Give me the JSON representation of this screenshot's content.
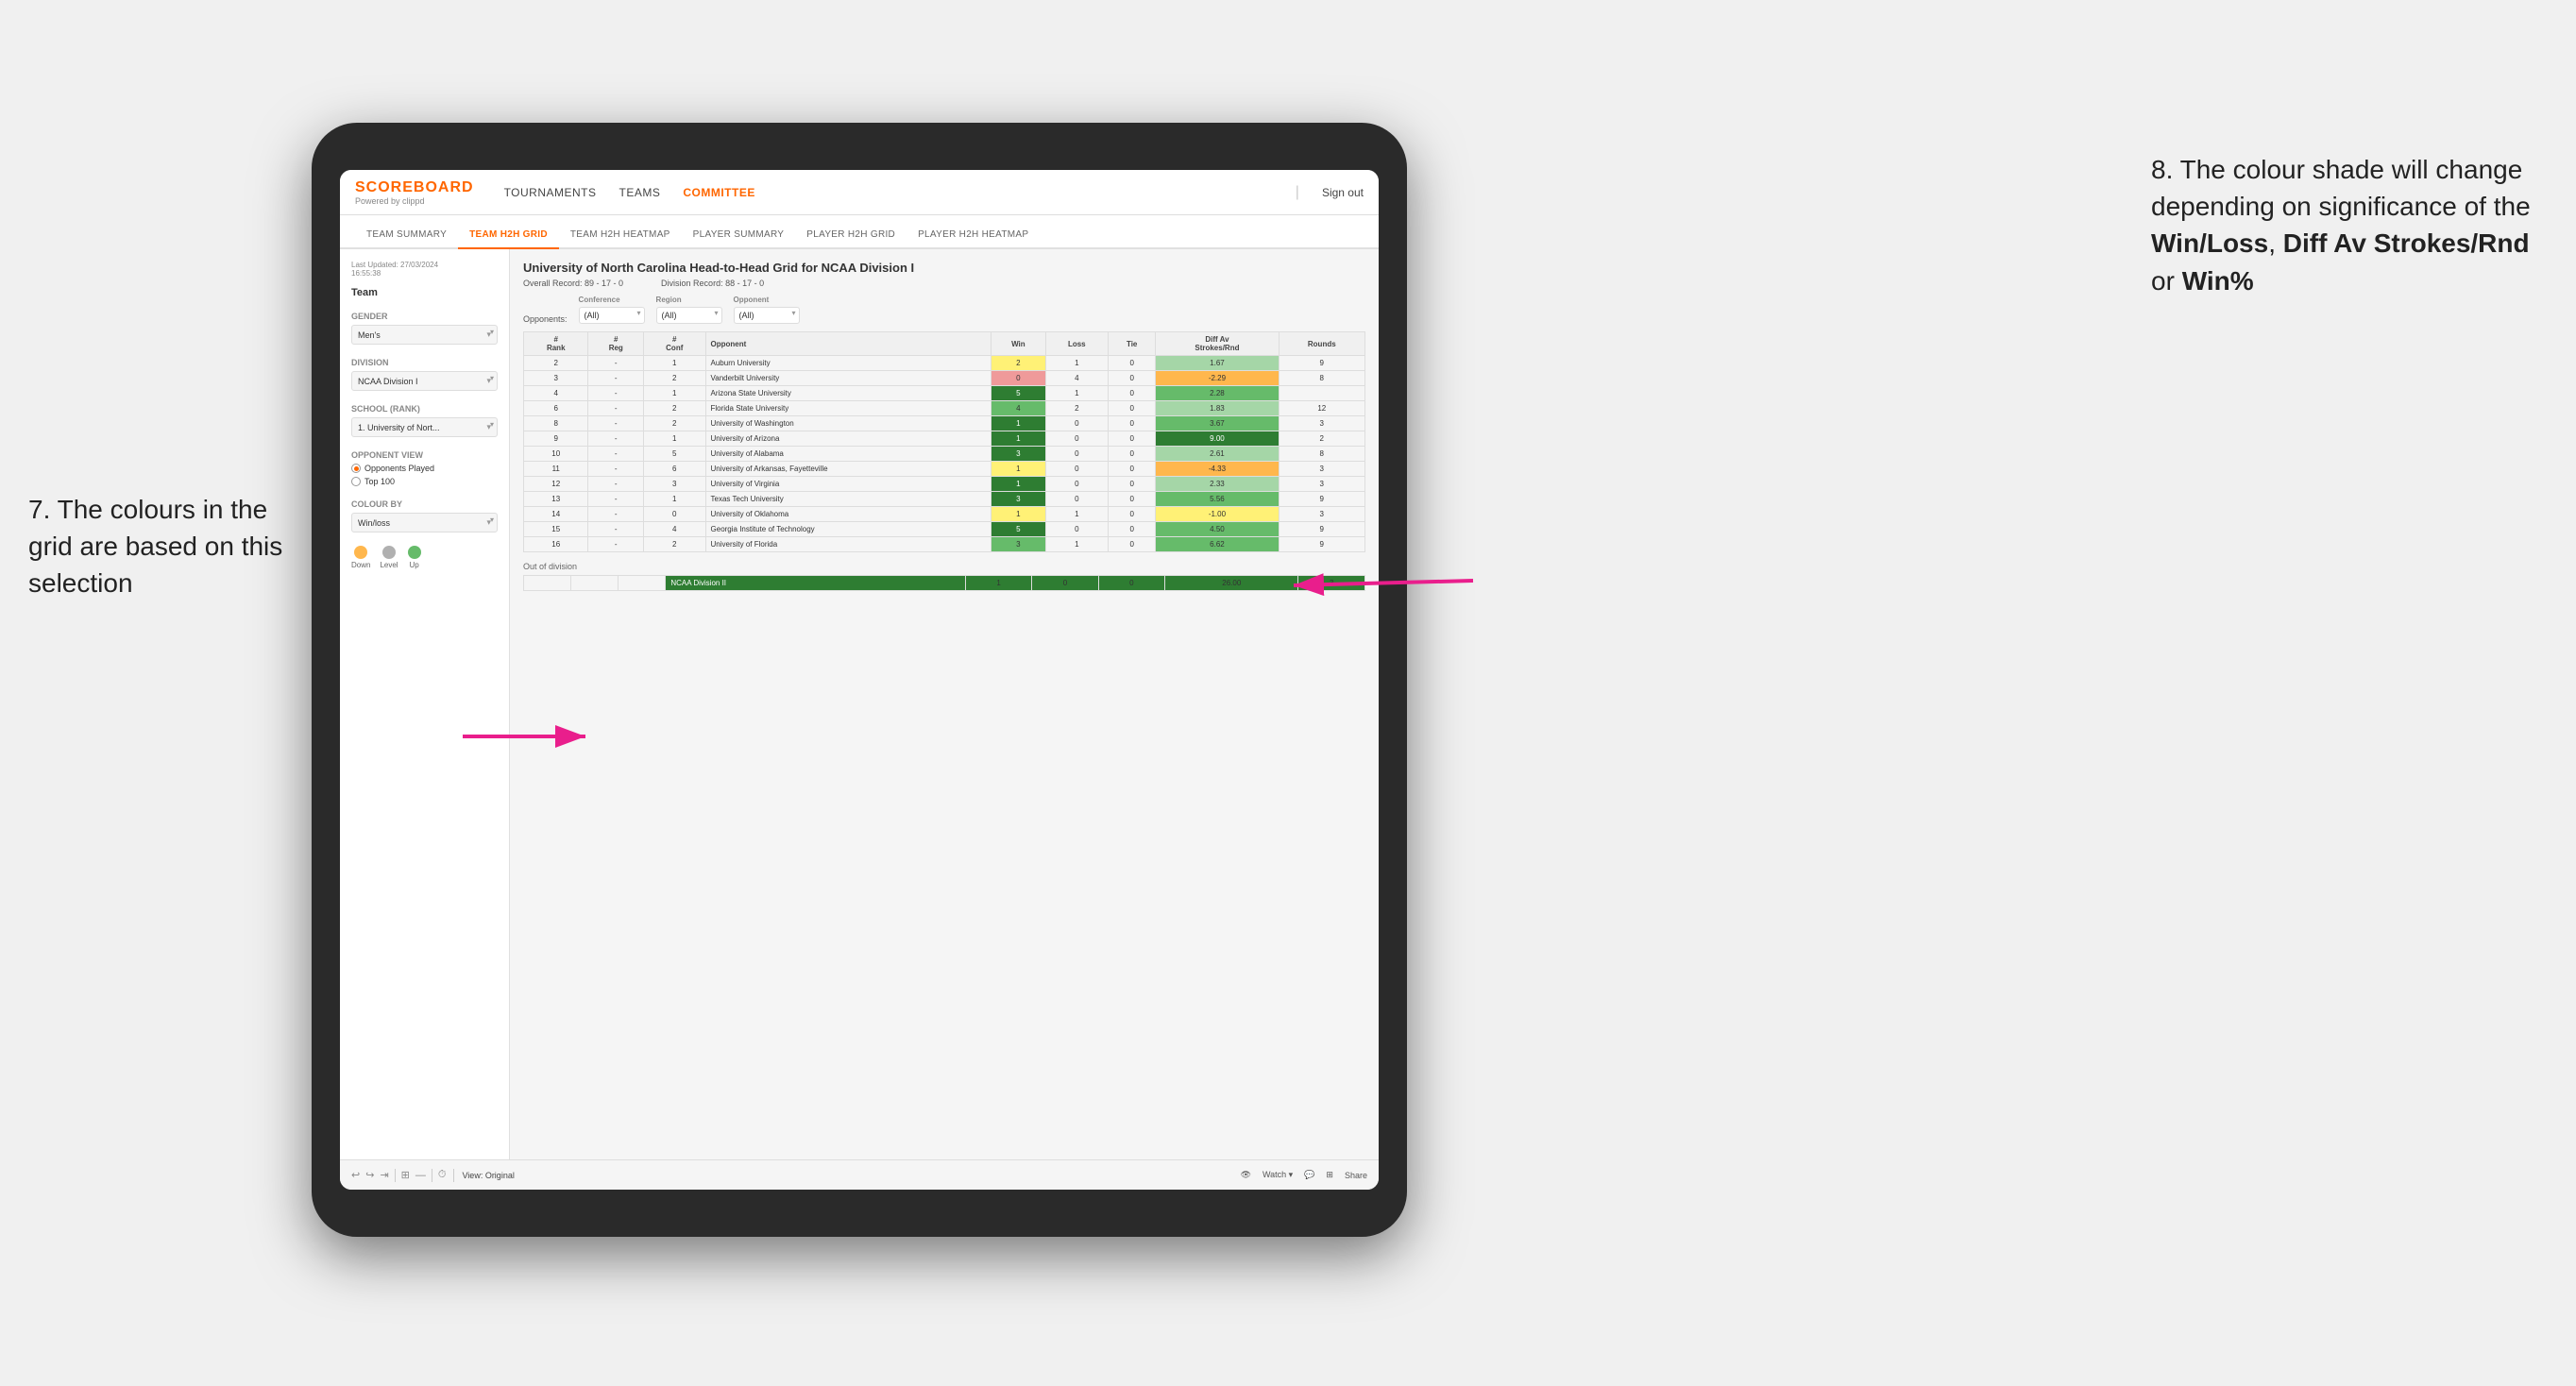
{
  "annotation_left": {
    "text": "7. The colours in the grid are based on this selection"
  },
  "annotation_right": {
    "line1": "8. The colour shade will change depending on significance of the ",
    "bold1": "Win/Loss",
    "line2": ", ",
    "bold2": "Diff Av Strokes/Rnd",
    "line3": " or ",
    "bold3": "Win%"
  },
  "tablet": {
    "nav": {
      "logo": "SCOREBOARD",
      "logo_sub": "Powered by clippd",
      "links": [
        "TOURNAMENTS",
        "TEAMS",
        "COMMITTEE"
      ],
      "sign_out": "Sign out"
    },
    "sub_tabs": [
      "TEAM SUMMARY",
      "TEAM H2H GRID",
      "TEAM H2H HEATMAP",
      "PLAYER SUMMARY",
      "PLAYER H2H GRID",
      "PLAYER H2H HEATMAP"
    ],
    "active_sub_tab": "TEAM H2H GRID",
    "sidebar": {
      "last_updated_label": "Last Updated: 27/03/2024",
      "last_updated_time": "16:55:38",
      "team_label": "Team",
      "gender_label": "Gender",
      "gender_value": "Men's",
      "division_label": "Division",
      "division_value": "NCAA Division I",
      "school_label": "School (Rank)",
      "school_value": "1. University of Nort...",
      "opponent_view_label": "Opponent View",
      "opponents_played": "Opponents Played",
      "top_100": "Top 100",
      "colour_by_label": "Colour by",
      "colour_by_value": "Win/loss",
      "legend": {
        "down_label": "Down",
        "level_label": "Level",
        "up_label": "Up",
        "down_color": "#ffb74d",
        "level_color": "#b0b0b0",
        "up_color": "#66bb6a"
      }
    },
    "grid": {
      "title": "University of North Carolina Head-to-Head Grid for NCAA Division I",
      "overall_record": "Overall Record: 89 - 17 - 0",
      "division_record": "Division Record: 88 - 17 - 0",
      "filters": {
        "conference_label": "Conference",
        "conference_value": "(All)",
        "region_label": "Region",
        "region_value": "(All)",
        "opponent_label": "Opponent",
        "opponent_value": "(All)",
        "opponents_label": "Opponents:"
      },
      "col_headers": [
        "#\nRank",
        "#\nReg",
        "#\nConf",
        "Opponent",
        "Win",
        "Loss",
        "Tie",
        "Diff Av\nStrokes/Rnd",
        "Rounds"
      ],
      "rows": [
        {
          "rank": "2",
          "reg": "-",
          "conf": "1",
          "opponent": "Auburn University",
          "win": "2",
          "loss": "1",
          "tie": "0",
          "diff": "1.67",
          "rounds": "9",
          "win_color": "yellow",
          "diff_color": "light-green"
        },
        {
          "rank": "3",
          "reg": "-",
          "conf": "2",
          "opponent": "Vanderbilt University",
          "win": "0",
          "loss": "4",
          "tie": "0",
          "diff": "-2.29",
          "rounds": "8",
          "win_color": "red",
          "diff_color": "orange"
        },
        {
          "rank": "4",
          "reg": "-",
          "conf": "1",
          "opponent": "Arizona State University",
          "win": "5",
          "loss": "1",
          "tie": "0",
          "diff": "2.28",
          "rounds": "",
          "win_color": "green-dark",
          "diff_color": "green"
        },
        {
          "rank": "6",
          "reg": "-",
          "conf": "2",
          "opponent": "Florida State University",
          "win": "4",
          "loss": "2",
          "tie": "0",
          "diff": "1.83",
          "rounds": "12",
          "win_color": "green",
          "diff_color": "light-green"
        },
        {
          "rank": "8",
          "reg": "-",
          "conf": "2",
          "opponent": "University of Washington",
          "win": "1",
          "loss": "0",
          "tie": "0",
          "diff": "3.67",
          "rounds": "3",
          "win_color": "green-dark",
          "diff_color": "green"
        },
        {
          "rank": "9",
          "reg": "-",
          "conf": "1",
          "opponent": "University of Arizona",
          "win": "1",
          "loss": "0",
          "tie": "0",
          "diff": "9.00",
          "rounds": "2",
          "win_color": "green-dark",
          "diff_color": "green-dark"
        },
        {
          "rank": "10",
          "reg": "-",
          "conf": "5",
          "opponent": "University of Alabama",
          "win": "3",
          "loss": "0",
          "tie": "0",
          "diff": "2.61",
          "rounds": "8",
          "win_color": "green-dark",
          "diff_color": "light-green"
        },
        {
          "rank": "11",
          "reg": "-",
          "conf": "6",
          "opponent": "University of Arkansas, Fayetteville",
          "win": "1",
          "loss": "0",
          "tie": "0",
          "diff": "-4.33",
          "rounds": "3",
          "win_color": "yellow",
          "diff_color": "orange"
        },
        {
          "rank": "12",
          "reg": "-",
          "conf": "3",
          "opponent": "University of Virginia",
          "win": "1",
          "loss": "0",
          "tie": "0",
          "diff": "2.33",
          "rounds": "3",
          "win_color": "green-dark",
          "diff_color": "light-green"
        },
        {
          "rank": "13",
          "reg": "-",
          "conf": "1",
          "opponent": "Texas Tech University",
          "win": "3",
          "loss": "0",
          "tie": "0",
          "diff": "5.56",
          "rounds": "9",
          "win_color": "green-dark",
          "diff_color": "green"
        },
        {
          "rank": "14",
          "reg": "-",
          "conf": "0",
          "opponent": "University of Oklahoma",
          "win": "1",
          "loss": "1",
          "tie": "0",
          "diff": "-1.00",
          "rounds": "3",
          "win_color": "yellow",
          "diff_color": "yellow"
        },
        {
          "rank": "15",
          "reg": "-",
          "conf": "4",
          "opponent": "Georgia Institute of Technology",
          "win": "5",
          "loss": "0",
          "tie": "0",
          "diff": "4.50",
          "rounds": "9",
          "win_color": "green-dark",
          "diff_color": "green"
        },
        {
          "rank": "16",
          "reg": "-",
          "conf": "2",
          "opponent": "University of Florida",
          "win": "3",
          "loss": "1",
          "tie": "0",
          "diff": "6.62",
          "rounds": "9",
          "win_color": "green",
          "diff_color": "green"
        }
      ],
      "out_of_division_label": "Out of division",
      "out_rows": [
        {
          "opponent": "NCAA Division II",
          "win": "1",
          "loss": "0",
          "tie": "0",
          "diff": "26.00",
          "rounds": "3",
          "win_color": "green-dark",
          "diff_color": "green-dark"
        }
      ]
    },
    "toolbar": {
      "view_label": "View: Original",
      "watch_label": "Watch ▾",
      "share_label": "Share"
    }
  }
}
